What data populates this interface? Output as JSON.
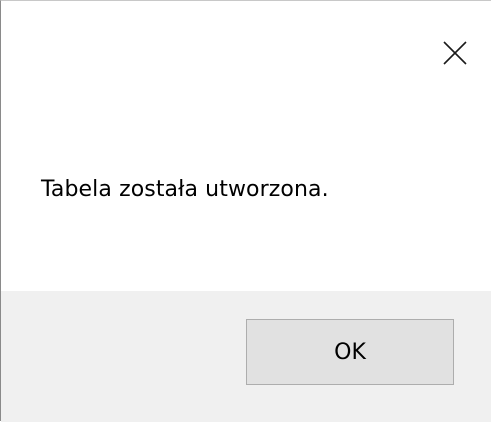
{
  "dialog": {
    "message": "Tabela została utworzona.",
    "ok_label": "OK",
    "close_icon": "close-icon"
  },
  "colors": {
    "content_background": "#ffffff",
    "footer_background": "#f0f0f0",
    "button_background": "#e1e1e1",
    "button_border": "#adadad",
    "text": "#000000"
  }
}
